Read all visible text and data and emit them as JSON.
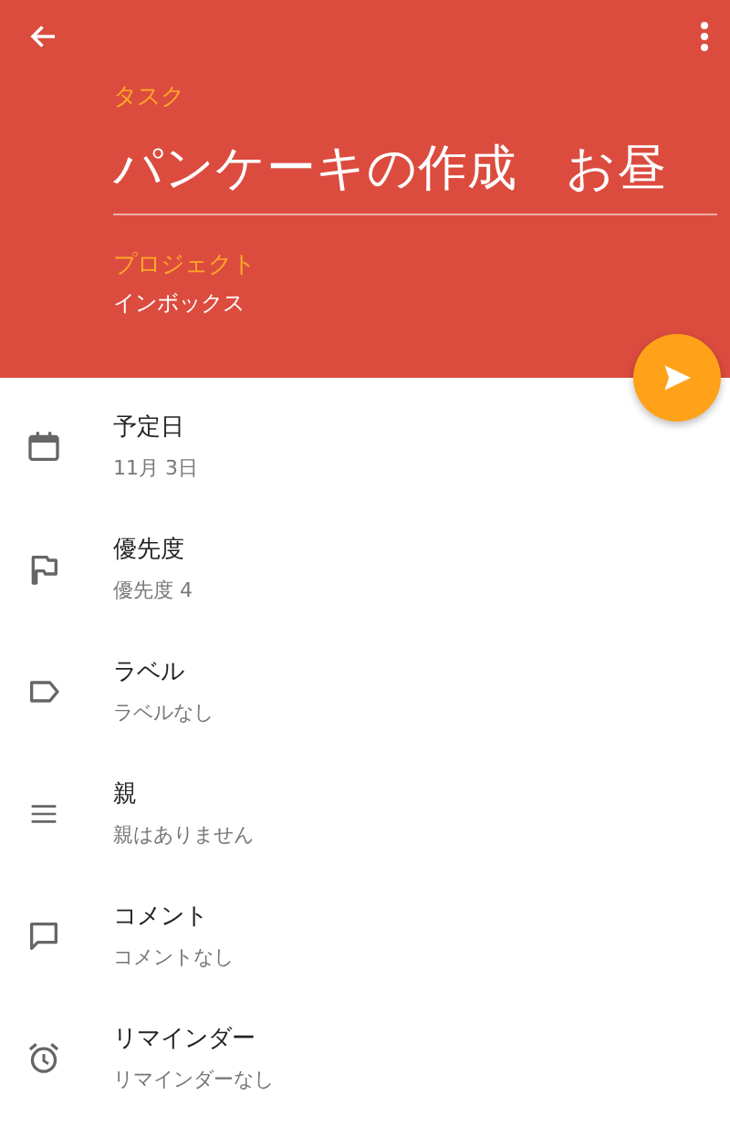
{
  "header": {
    "task_label": "タスク",
    "task_value": "パンケーキの作成　お昼",
    "project_label": "プロジェクト",
    "project_value": "インボックス"
  },
  "rows": [
    {
      "kind": "date",
      "title": "予定日",
      "subtitle": "11月 3日"
    },
    {
      "kind": "priority",
      "title": "優先度",
      "subtitle": "優先度 4"
    },
    {
      "kind": "label",
      "title": "ラベル",
      "subtitle": "ラベルなし"
    },
    {
      "kind": "parent",
      "title": "親",
      "subtitle": "親はありません"
    },
    {
      "kind": "comment",
      "title": "コメント",
      "subtitle": "コメントなし"
    },
    {
      "kind": "reminder",
      "title": "リマインダー",
      "subtitle": "リマインダーなし"
    }
  ]
}
